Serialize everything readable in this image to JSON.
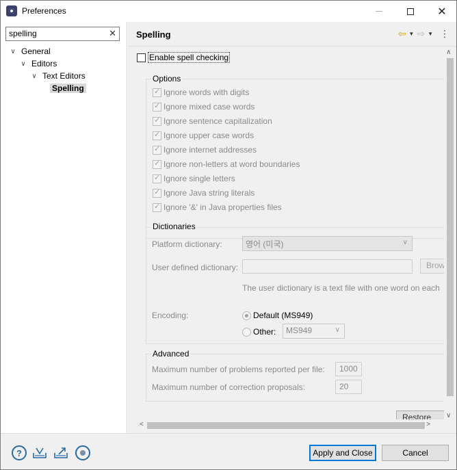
{
  "window": {
    "title": "Preferences"
  },
  "left": {
    "filter": {
      "value": "spelling",
      "clear_glyph": "✕"
    },
    "tree": [
      {
        "label": "General",
        "expanded": true
      },
      {
        "label": "Editors",
        "expanded": true
      },
      {
        "label": "Text Editors",
        "expanded": true
      },
      {
        "label": "Spelling",
        "selected": true
      }
    ]
  },
  "page": {
    "title": "Spelling",
    "enable_spell_checking": {
      "label": "Enable spell checking",
      "checked": false
    },
    "options": {
      "title": "Options",
      "items": [
        "Ignore words with digits",
        "Ignore mixed case words",
        "Ignore sentence capitalization",
        "Ignore upper case words",
        "Ignore internet addresses",
        "Ignore non-letters at word boundaries",
        "Ignore single letters",
        "Ignore Java string literals",
        "Ignore '&' in Java properties files"
      ]
    },
    "dictionaries": {
      "title": "Dictionaries",
      "platform_label": "Platform dictionary:",
      "platform_value": "영어 (미국)",
      "user_label": "User defined dictionary:",
      "user_value": "",
      "browse_label": "Brow",
      "hint": "The user dictionary is a text file with one word on each",
      "encoding_label": "Encoding:",
      "default_label": "Default (MS949)",
      "other_label": "Other:",
      "other_value": "MS949"
    },
    "advanced": {
      "title": "Advanced",
      "max_problems_label": "Maximum number of problems reported per file:",
      "max_problems_value": "1000",
      "max_proposals_label": "Maximum number of correction proposals:",
      "max_proposals_value": "20"
    },
    "restore_defaults_label": "Restore Def"
  },
  "footer": {
    "apply_close_label": "Apply and Close",
    "cancel_label": "Cancel"
  }
}
